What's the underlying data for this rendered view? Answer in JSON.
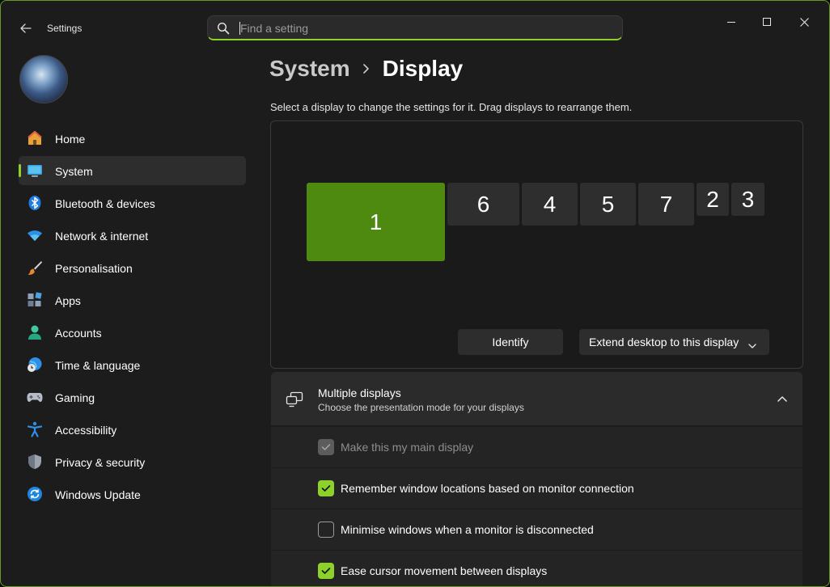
{
  "app": {
    "title": "Settings"
  },
  "search": {
    "placeholder": "Find a setting"
  },
  "sidebar": {
    "items": [
      {
        "label": "Home",
        "icon": "home-icon",
        "selected": false
      },
      {
        "label": "System",
        "icon": "display-icon",
        "selected": true
      },
      {
        "label": "Bluetooth & devices",
        "icon": "bluetooth-icon",
        "selected": false
      },
      {
        "label": "Network & internet",
        "icon": "wifi-icon",
        "selected": false
      },
      {
        "label": "Personalisation",
        "icon": "brush-icon",
        "selected": false
      },
      {
        "label": "Apps",
        "icon": "apps-icon",
        "selected": false
      },
      {
        "label": "Accounts",
        "icon": "person-icon",
        "selected": false
      },
      {
        "label": "Time & language",
        "icon": "globe-clock-icon",
        "selected": false
      },
      {
        "label": "Gaming",
        "icon": "gamepad-icon",
        "selected": false
      },
      {
        "label": "Accessibility",
        "icon": "accessibility-icon",
        "selected": false
      },
      {
        "label": "Privacy & security",
        "icon": "shield-icon",
        "selected": false
      },
      {
        "label": "Windows Update",
        "icon": "update-icon",
        "selected": false
      }
    ]
  },
  "breadcrumb": {
    "parent": "System",
    "current": "Display"
  },
  "display_arrangement": {
    "description": "Select a display to change the settings for it. Drag displays to rearrange them.",
    "monitors": [
      "1",
      "6",
      "4",
      "5",
      "7",
      "2",
      "3"
    ],
    "selected_monitor": "1",
    "identify_label": "Identify",
    "mode_dropdown_value": "Extend desktop to this display"
  },
  "multiple_displays": {
    "title": "Multiple displays",
    "subtitle": "Choose the presentation mode for your displays",
    "expanded": true,
    "options": [
      {
        "label": "Make this my main display",
        "checked": true,
        "disabled": true
      },
      {
        "label": "Remember window locations based on monitor connection",
        "checked": true,
        "disabled": false
      },
      {
        "label": "Minimise windows when a monitor is disconnected",
        "checked": false,
        "disabled": false
      },
      {
        "label": "Ease cursor movement between displays",
        "checked": true,
        "disabled": false
      }
    ]
  },
  "colors": {
    "accent": "#8cd22a",
    "selected_display": "#4f8a10",
    "window_bg": "#1c1c1c"
  }
}
